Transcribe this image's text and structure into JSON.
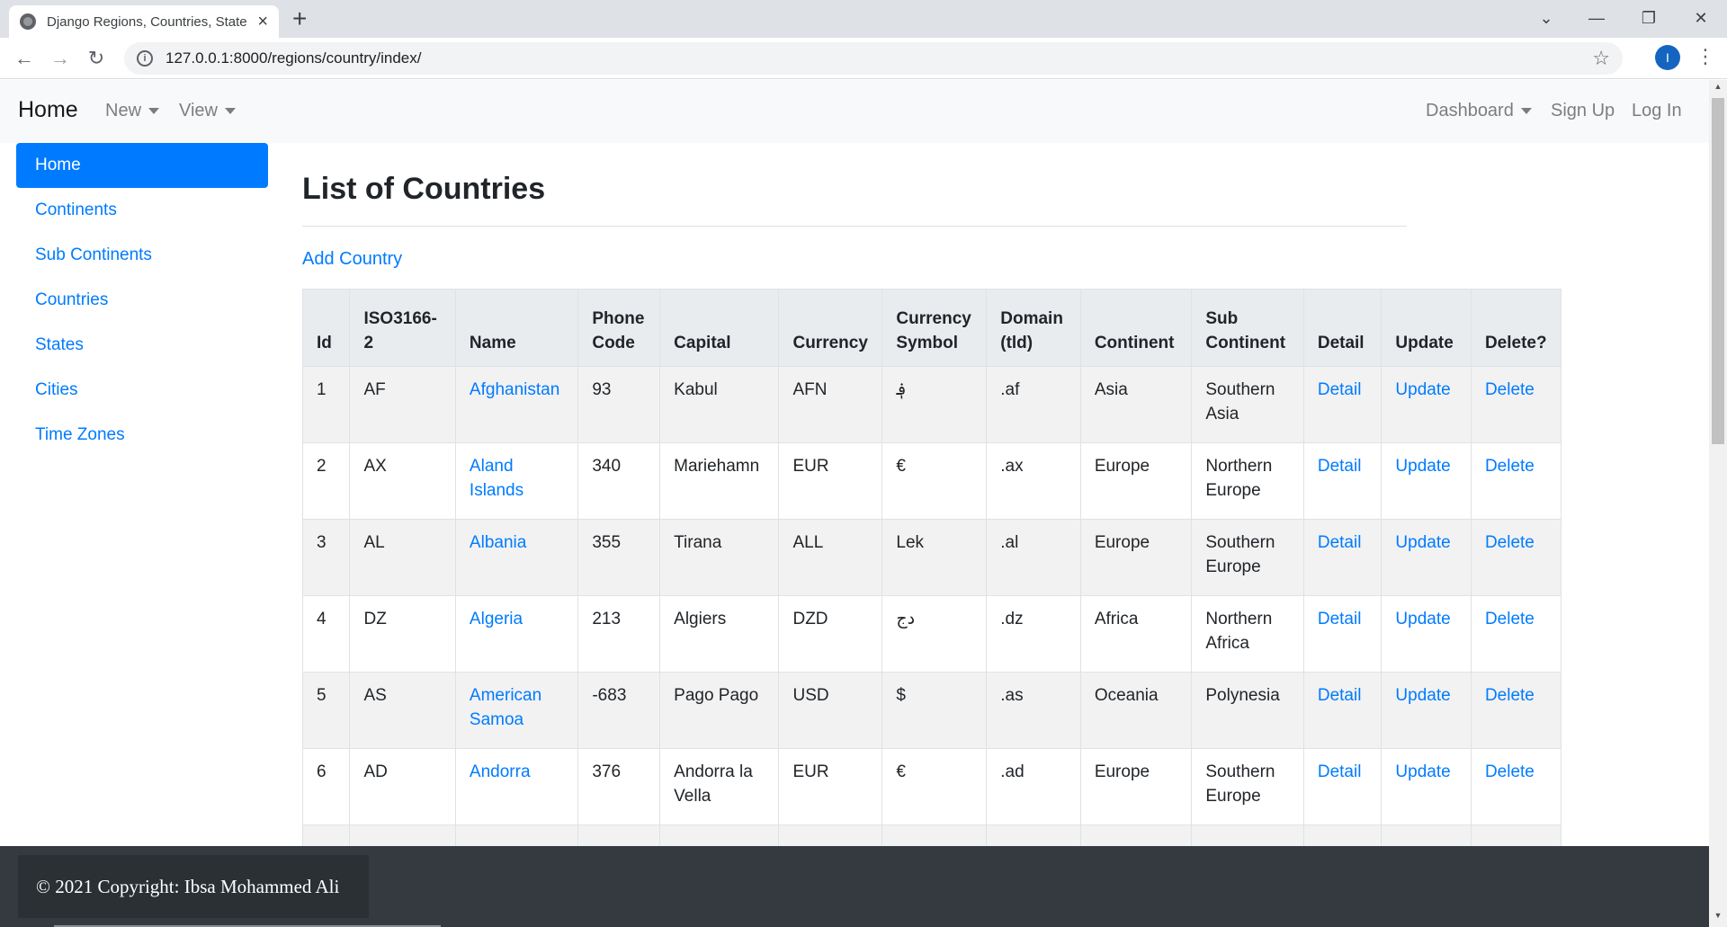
{
  "browser": {
    "tab_title": "Django Regions, Countries, State",
    "url": "127.0.0.1:8000/regions/country/index/"
  },
  "navbar": {
    "brand": "Home",
    "new": "New",
    "view": "View",
    "dashboard": "Dashboard",
    "signup": "Sign Up",
    "login": "Log In"
  },
  "sidebar": {
    "items": [
      {
        "label": "Home"
      },
      {
        "label": "Continents"
      },
      {
        "label": "Sub Continents"
      },
      {
        "label": "Countries"
      },
      {
        "label": "States"
      },
      {
        "label": "Cities"
      },
      {
        "label": "Time Zones"
      }
    ]
  },
  "main": {
    "title": "List of Countries",
    "add_link": "Add Country"
  },
  "table": {
    "headers": [
      "Id",
      "ISO3166-2",
      "Name",
      "Phone Code",
      "Capital",
      "Currency",
      "Currency Symbol",
      "Domain (tld)",
      "Continent",
      "Sub Continent",
      "Detail",
      "Update",
      "Delete?"
    ],
    "rows": [
      [
        "1",
        "AF",
        "Afghanistan",
        "93",
        "Kabul",
        "AFN",
        "؋",
        ".af",
        "Asia",
        "Southern Asia",
        "Detail",
        "Update",
        "Delete"
      ],
      [
        "2",
        "AX",
        "Aland Islands",
        "340",
        "Mariehamn",
        "EUR",
        "€",
        ".ax",
        "Europe",
        "Northern Europe",
        "Detail",
        "Update",
        "Delete"
      ],
      [
        "3",
        "AL",
        "Albania",
        "355",
        "Tirana",
        "ALL",
        "Lek",
        ".al",
        "Europe",
        "Southern Europe",
        "Detail",
        "Update",
        "Delete"
      ],
      [
        "4",
        "DZ",
        "Algeria",
        "213",
        "Algiers",
        "DZD",
        "دج",
        ".dz",
        "Africa",
        "Northern Africa",
        "Detail",
        "Update",
        "Delete"
      ],
      [
        "5",
        "AS",
        "American Samoa",
        "-683",
        "Pago Pago",
        "USD",
        "$",
        ".as",
        "Oceania",
        "Polynesia",
        "Detail",
        "Update",
        "Delete"
      ],
      [
        "6",
        "AD",
        "Andorra",
        "376",
        "Andorra la Vella",
        "EUR",
        "€",
        ".ad",
        "Europe",
        "Southern Europe",
        "Detail",
        "Update",
        "Delete"
      ],
      [
        "",
        "",
        "",
        "",
        "",
        "",
        "",
        "",
        "",
        "",
        "",
        "",
        ""
      ]
    ]
  },
  "footer": {
    "copyright": "© 2021 Copyright: Ibsa Mohammed Ali"
  }
}
